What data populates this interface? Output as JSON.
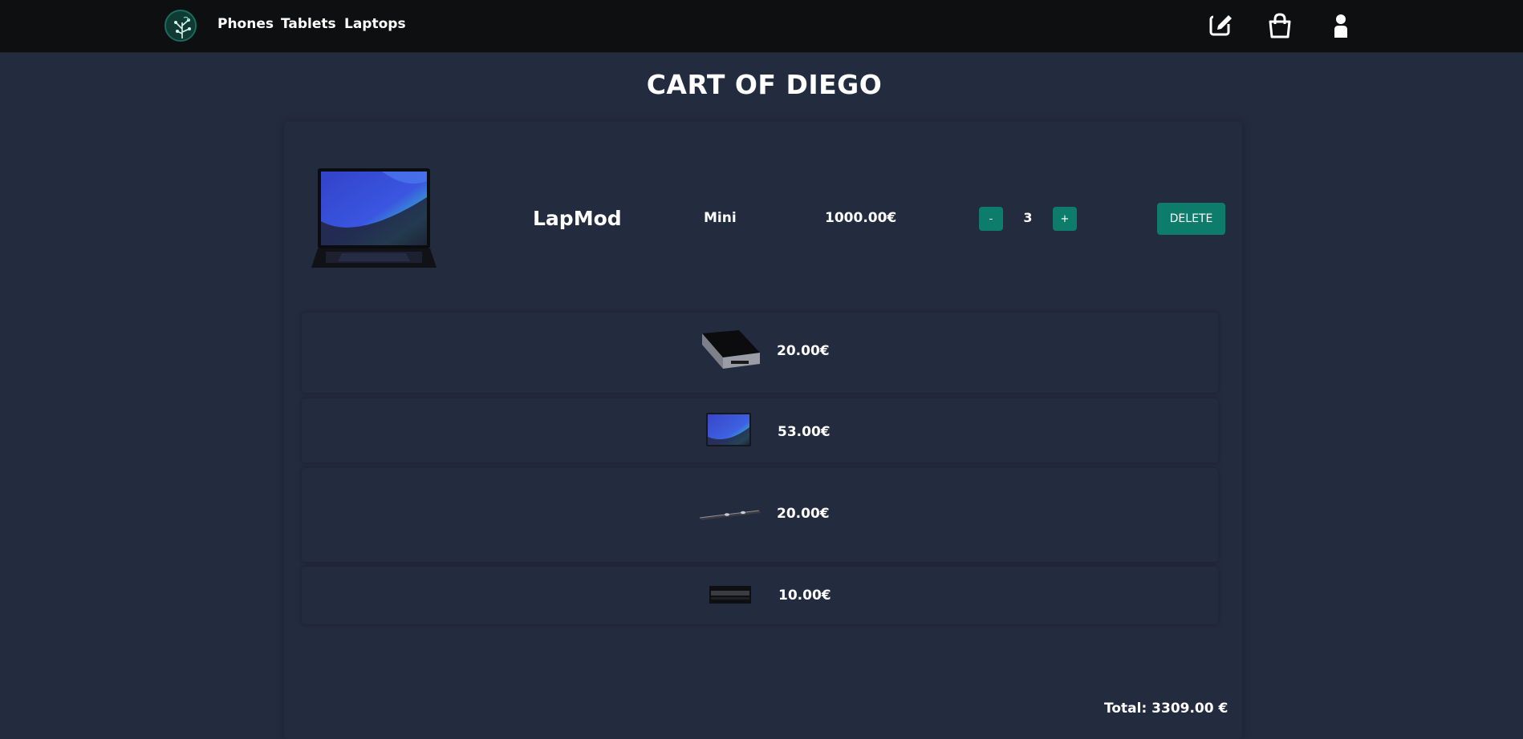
{
  "navbar": {
    "logo_icon": "circuit-leaf-logo-icon",
    "links": [
      {
        "label": "Phones"
      },
      {
        "label": "Tablets"
      },
      {
        "label": "Laptops"
      }
    ],
    "icons": [
      "edit-icon",
      "shopping-bag-icon",
      "user-icon"
    ]
  },
  "page": {
    "title": "CART OF DIEGO"
  },
  "cart": {
    "item": {
      "name": "LapMod",
      "variant": "Mini",
      "price": "1000.00€",
      "quantity": "3",
      "minus_label": "-",
      "plus_label": "+",
      "delete_label": "DELETE"
    },
    "accessories": [
      {
        "price": "20.00€",
        "icon": "storage-box-icon"
      },
      {
        "price": "53.00€",
        "icon": "screen-panel-icon"
      },
      {
        "price": "20.00€",
        "icon": "thin-bar-icon"
      },
      {
        "price": "10.00€",
        "icon": "battery-block-icon"
      }
    ],
    "total": "Total: 3309.00 €"
  },
  "colors": {
    "navbar": "#0e0f10",
    "background": "#232b3f",
    "accent": "#0e7c6b"
  }
}
